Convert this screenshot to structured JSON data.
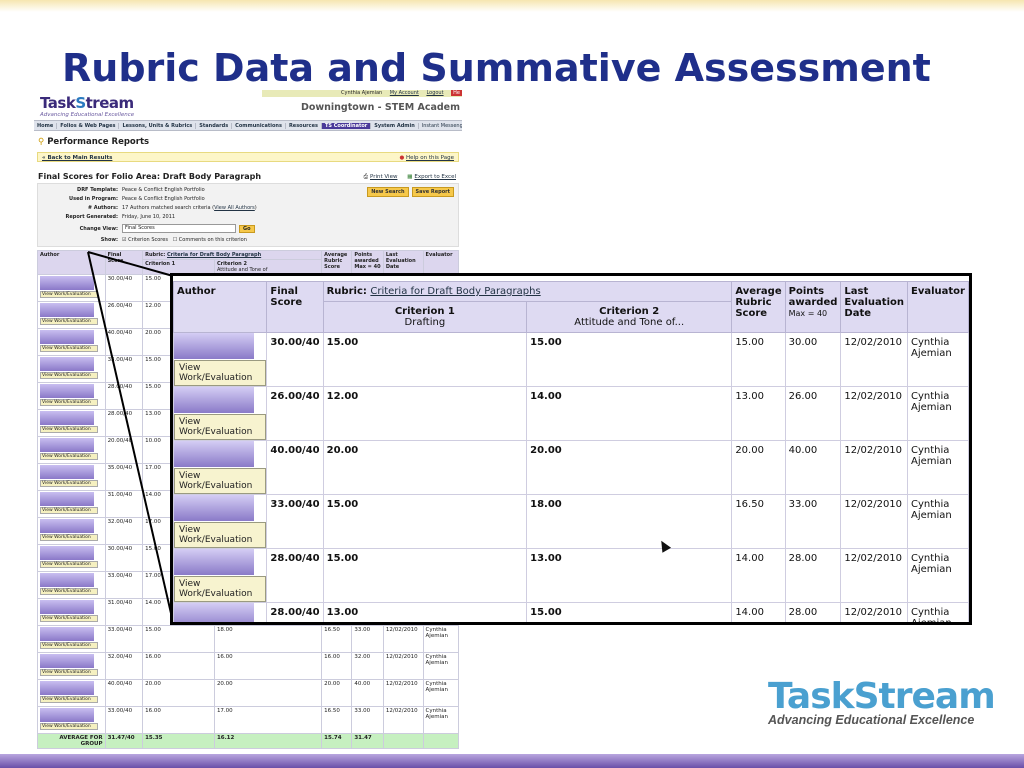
{
  "slide_title": "Rubric Data and Summative Assessment",
  "logo": {
    "brand_a": "Task",
    "brand_s": "S",
    "brand_b": "tream",
    "tagline": "Advancing Educational Excellence"
  },
  "userbar": {
    "user": "Cynthia Ajemian",
    "my_account": "My Account",
    "logout": "Logout",
    "help": "He"
  },
  "district": "Downingtown - STEM Academ",
  "nav": [
    "Home",
    "Folios & Web Pages",
    "Lessons, Units & Rubrics",
    "Standards",
    "Communications",
    "Resources",
    "TS Coordinator",
    "System Admin",
    "Instant Messeng"
  ],
  "report": {
    "section_title": "Performance Reports",
    "back_link": "« Back to Main Results",
    "help_link": "Help on this Page",
    "title": "Final Scores for Folio Area: Draft Body Paragraph",
    "print_view": "Print View",
    "export": "Export to Excel",
    "new_search": "New Search",
    "save_report": "Save Report",
    "info": [
      {
        "label": "DRF Template:",
        "value": "Peace & Conflict English Portfolio"
      },
      {
        "label": "Used in Program:",
        "value": "Peace & Conflict English Portfolio"
      },
      {
        "label": "# Authors:",
        "value": "17 Authors matched search criteria (",
        "link": "View All Authors",
        "after": ")"
      },
      {
        "label": "Report Generated:",
        "value": "Friday, June 10, 2011"
      }
    ],
    "change_view_label": "Change View:",
    "change_view_value": "Final Scores",
    "go": "Go",
    "show_label": "Show:",
    "show_opt1": "Criterion Scores",
    "show_opt2": "Comments on this criterion"
  },
  "table_headers": {
    "author": "Author",
    "final": "Final",
    "score": "Score",
    "rubric_label": "Rubric:",
    "rubric_link": "Criteria for Draft Body Paragraphs",
    "rubric_link_small": "Criteria for Draft Body Paragraph",
    "crit1": "Criterion 1",
    "crit1_sub": "Drafting",
    "crit2": "Criterion 2",
    "crit2_sub": "Attitude and Tone of...",
    "crit2_small_sub": "Attitude and Tone of",
    "avg": "Average Rubric Score",
    "avg_small": "Average Rubric Score",
    "points": "Points awarded",
    "points_small": "Points awarded",
    "points_max": "Max = 40",
    "last": "Last Evaluation Date",
    "last_small": "Last Evaluation Date",
    "evaluator": "Evaluator"
  },
  "view_label": "View Work/Evaluation",
  "small_rows": [
    {
      "final": "30.00/40",
      "c1": "15.00"
    },
    {
      "final": "26.00/40",
      "c1": "12.00"
    },
    {
      "final": "40.00/40",
      "c1": "20.00"
    },
    {
      "final": "33.00/40",
      "c1": "15.00"
    },
    {
      "final": "28.00/40",
      "c1": "15.00"
    },
    {
      "final": "28.00/40",
      "c1": "13.00"
    },
    {
      "final": "20.00/40",
      "c1": "10.00"
    },
    {
      "final": "35.00/40",
      "c1": "17.00"
    },
    {
      "final": "31.00/40",
      "c1": "14.00"
    },
    {
      "final": "32.00/40",
      "c1": "17.00"
    },
    {
      "final": "30.00/40",
      "c1": "15.00"
    },
    {
      "final": "33.00/40",
      "c1": "17.00"
    },
    {
      "final": "31.00/40",
      "c1": "14.00"
    },
    {
      "final": "33.00/40",
      "c1": "15.00",
      "c2": "18.00",
      "avg": "16.50",
      "pts": "33.00",
      "date": "12/02/2010",
      "eval": "Cynthia Ajemian"
    },
    {
      "final": "32.00/40",
      "c1": "16.00",
      "c2": "16.00",
      "avg": "16.00",
      "pts": "32.00",
      "date": "12/02/2010",
      "eval": "Cynthia Ajemian"
    },
    {
      "final": "40.00/40",
      "c1": "20.00",
      "c2": "20.00",
      "avg": "20.00",
      "pts": "40.00",
      "date": "12/02/2010",
      "eval": "Cynthia Ajemian"
    },
    {
      "final": "33.00/40",
      "c1": "16.00",
      "c2": "17.00",
      "avg": "16.50",
      "pts": "33.00",
      "date": "12/02/2010",
      "eval": "Cynthia Ajemian"
    }
  ],
  "avg_row": {
    "label": "AVERAGE FOR GROUP",
    "final": "31.47/40",
    "c1": "15.35",
    "c2": "16.12",
    "avg": "15.74",
    "pts": "31.47"
  },
  "zoom_rows": [
    {
      "final": "30.00/40",
      "c1": "15.00",
      "c2": "15.00",
      "avg": "15.00",
      "pts": "30.00",
      "date": "12/02/2010",
      "eval": "Cynthia Ajemian"
    },
    {
      "final": "26.00/40",
      "c1": "12.00",
      "c2": "14.00",
      "avg": "13.00",
      "pts": "26.00",
      "date": "12/02/2010",
      "eval": "Cynthia Ajemian"
    },
    {
      "final": "40.00/40",
      "c1": "20.00",
      "c2": "20.00",
      "avg": "20.00",
      "pts": "40.00",
      "date": "12/02/2010",
      "eval": "Cynthia Ajemian"
    },
    {
      "final": "33.00/40",
      "c1": "15.00",
      "c2": "18.00",
      "avg": "16.50",
      "pts": "33.00",
      "date": "12/02/2010",
      "eval": "Cynthia Ajemian"
    },
    {
      "final": "28.00/40",
      "c1": "15.00",
      "c2": "13.00",
      "avg": "14.00",
      "pts": "28.00",
      "date": "12/02/2010",
      "eval": "Cynthia Ajemian"
    },
    {
      "final": "28.00/40",
      "c1": "13.00",
      "c2": "15.00",
      "avg": "14.00",
      "pts": "28.00",
      "date": "12/02/2010",
      "eval": "Cynthia Ajemian"
    }
  ]
}
